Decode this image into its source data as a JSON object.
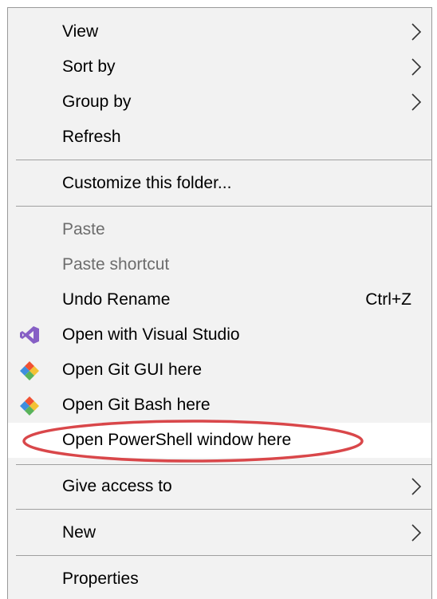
{
  "menu": {
    "items": [
      {
        "label": "View",
        "has_submenu": true
      },
      {
        "label": "Sort by",
        "has_submenu": true
      },
      {
        "label": "Group by",
        "has_submenu": true
      },
      {
        "label": "Refresh"
      },
      {
        "label": "Customize this folder..."
      },
      {
        "label": "Paste",
        "disabled": true
      },
      {
        "label": "Paste shortcut",
        "disabled": true
      },
      {
        "label": "Undo Rename",
        "shortcut": "Ctrl+Z"
      },
      {
        "label": "Open with Visual Studio",
        "icon": "visual-studio-icon"
      },
      {
        "label": "Open Git GUI here",
        "icon": "git-gui-icon"
      },
      {
        "label": "Open Git Bash here",
        "icon": "git-bash-icon"
      },
      {
        "label": "Open PowerShell window here",
        "highlighted": true
      },
      {
        "label": "Give access to",
        "has_submenu": true
      },
      {
        "label": "New",
        "has_submenu": true
      },
      {
        "label": "Properties"
      }
    ]
  },
  "colors": {
    "menu_background": "#f2f2f2",
    "highlight_background": "#ffffff",
    "annotation_ellipse": "#d9474a",
    "disabled_text": "#6d6d6d",
    "visual_studio_purple": "#865fc5"
  }
}
